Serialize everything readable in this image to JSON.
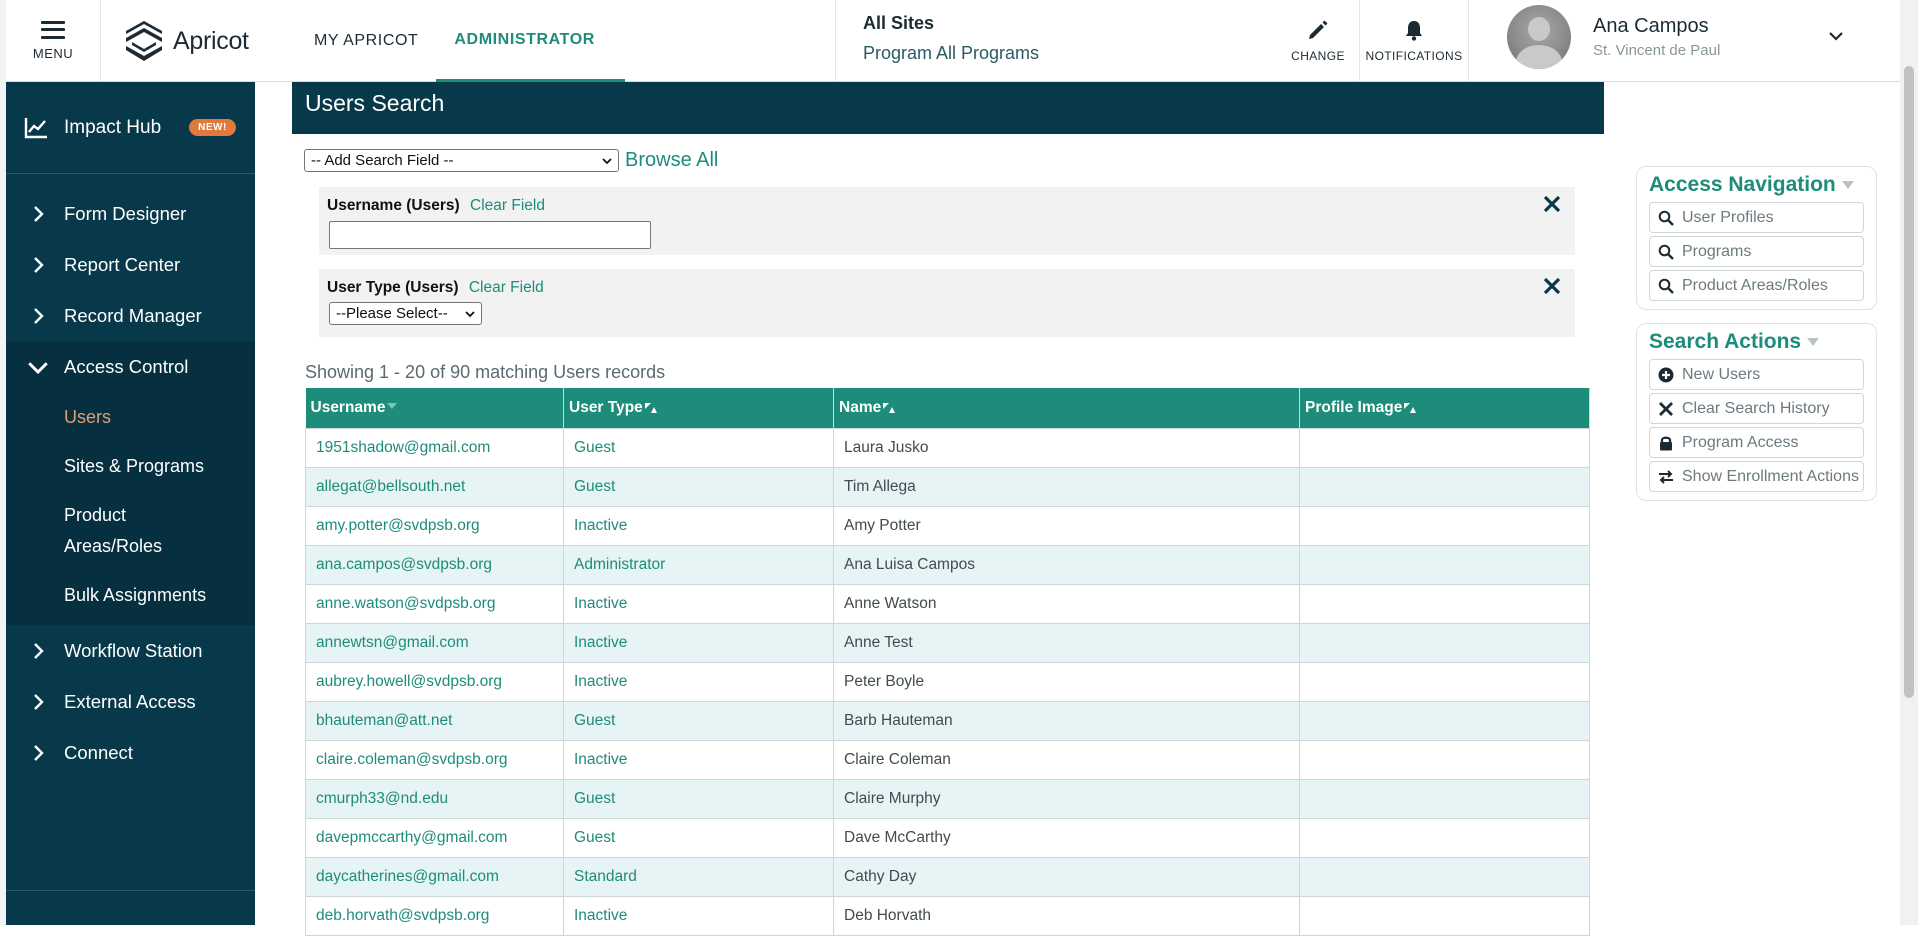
{
  "header": {
    "menu_label": "MENU",
    "logo_text": "Apricot",
    "tabs": [
      {
        "label": "MY APRICOT",
        "active": false
      },
      {
        "label": "ADMINISTRATOR",
        "active": true
      }
    ],
    "site_title": "All Sites",
    "program_line": "Program All Programs",
    "change_label": "CHANGE",
    "notifications_label": "NOTIFICATIONS",
    "user_name": "Ana Campos",
    "user_org": "St. Vincent de Paul"
  },
  "sidebar": {
    "impact_hub": {
      "label": "Impact Hub",
      "badge": "NEW!"
    },
    "items": [
      {
        "label": "Form Designer"
      },
      {
        "label": "Report Center"
      },
      {
        "label": "Record Manager"
      },
      {
        "label": "Access Control"
      },
      {
        "label": "Workflow Station"
      },
      {
        "label": "External Access"
      },
      {
        "label": "Connect"
      }
    ],
    "access_control_sub": [
      {
        "label": "Users",
        "active": true
      },
      {
        "label": "Sites & Programs",
        "active": false
      },
      {
        "label": "Product",
        "active": false
      },
      {
        "label": "Areas/Roles",
        "active": false
      },
      {
        "label": "Bulk Assignments",
        "active": false
      }
    ]
  },
  "main": {
    "title": "Users Search",
    "add_field_select": "-- Add Search Field --",
    "browse_all": "Browse All",
    "fields": [
      {
        "label": "Username (Users)",
        "clear": "Clear Field",
        "value": ""
      },
      {
        "label": "User Type (Users)",
        "clear": "Clear Field",
        "select_value": "--Please Select--"
      }
    ],
    "showing_text": "Showing 1 - 20 of 90 matching Users records",
    "columns": [
      "Username",
      "User Type",
      "Name",
      "Profile Image"
    ],
    "rows": [
      {
        "username": "1951shadow@gmail.com",
        "type": "Guest",
        "name": "Laura Jusko"
      },
      {
        "username": "allegat@bellsouth.net",
        "type": "Guest",
        "name": "Tim Allega"
      },
      {
        "username": "amy.potter@svdpsb.org",
        "type": "Inactive",
        "name": "Amy Potter"
      },
      {
        "username": "ana.campos@svdpsb.org",
        "type": "Administrator",
        "name": "Ana Luisa Campos"
      },
      {
        "username": "anne.watson@svdpsb.org",
        "type": "Inactive",
        "name": "Anne Watson"
      },
      {
        "username": "annewtsn@gmail.com",
        "type": "Inactive",
        "name": "Anne Test"
      },
      {
        "username": "aubrey.howell@svdpsb.org",
        "type": "Inactive",
        "name": "Peter Boyle"
      },
      {
        "username": "bhauteman@att.net",
        "type": "Guest",
        "name": "Barb Hauteman"
      },
      {
        "username": "claire.coleman@svdpsb.org",
        "type": "Inactive",
        "name": "Claire Coleman"
      },
      {
        "username": "cmurph33@nd.edu",
        "type": "Guest",
        "name": "Claire Murphy"
      },
      {
        "username": "davepmccarthy@gmail.com",
        "type": "Guest",
        "name": "Dave McCarthy"
      },
      {
        "username": "daycatherines@gmail.com",
        "type": "Standard",
        "name": "Cathy Day"
      },
      {
        "username": "deb.horvath@svdpsb.org",
        "type": "Inactive",
        "name": "Deb Horvath"
      }
    ]
  },
  "panels": {
    "access_navigation": {
      "title": "Access Navigation",
      "buttons": [
        "User Profiles",
        "Programs",
        "Product Areas/Roles"
      ]
    },
    "search_actions": {
      "title": "Search Actions",
      "buttons": [
        "New Users",
        "Clear Search History",
        "Program Access",
        "Show Enrollment Actions"
      ]
    }
  },
  "colors": {
    "navy": "#08394a",
    "teal": "#1e8c7a",
    "orange_badge": "#e0793a",
    "active_sub": "#e0a06e",
    "row_alt": "#e6f4f5"
  }
}
